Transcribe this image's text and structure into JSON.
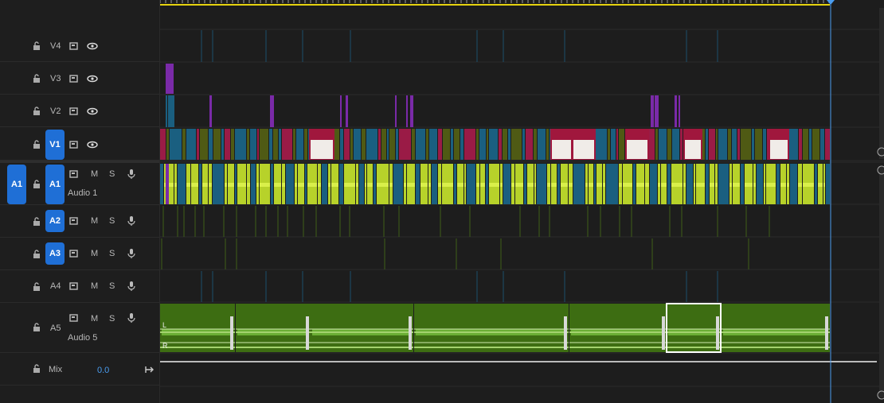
{
  "tracks": {
    "v4": {
      "label": "V4"
    },
    "v3": {
      "label": "V3"
    },
    "v2": {
      "label": "V2"
    },
    "v1": {
      "label": "V1"
    },
    "a1": {
      "label": "A1",
      "source": "A1",
      "name": "Audio 1"
    },
    "a2": {
      "label": "A2"
    },
    "a3": {
      "label": "A3"
    },
    "a4": {
      "label": "A4"
    },
    "a5": {
      "label": "A5",
      "name": "Audio 5"
    },
    "mix": {
      "label": "Mix",
      "value": "0.0"
    }
  },
  "buttons": {
    "mute": "M",
    "solo": "S"
  },
  "a5_channels": {
    "left": "L",
    "right": "R"
  },
  "colors": {
    "accent_blue": "#1f6fd6",
    "ruler_yellow": "#e6d20f",
    "playhead": "#4a9df0",
    "clip_crimson": "#9a1b46",
    "clip_olive": "#4f5a14",
    "clip_teal": "#1a5f80",
    "audio_lime": "#b7d22a",
    "audio_green": "#3d6d12",
    "purple_clip": "#7a2aa8"
  },
  "icons": [
    "lock-icon",
    "film-icon",
    "eye-icon",
    "mic-icon",
    "mix-end-icon"
  ]
}
